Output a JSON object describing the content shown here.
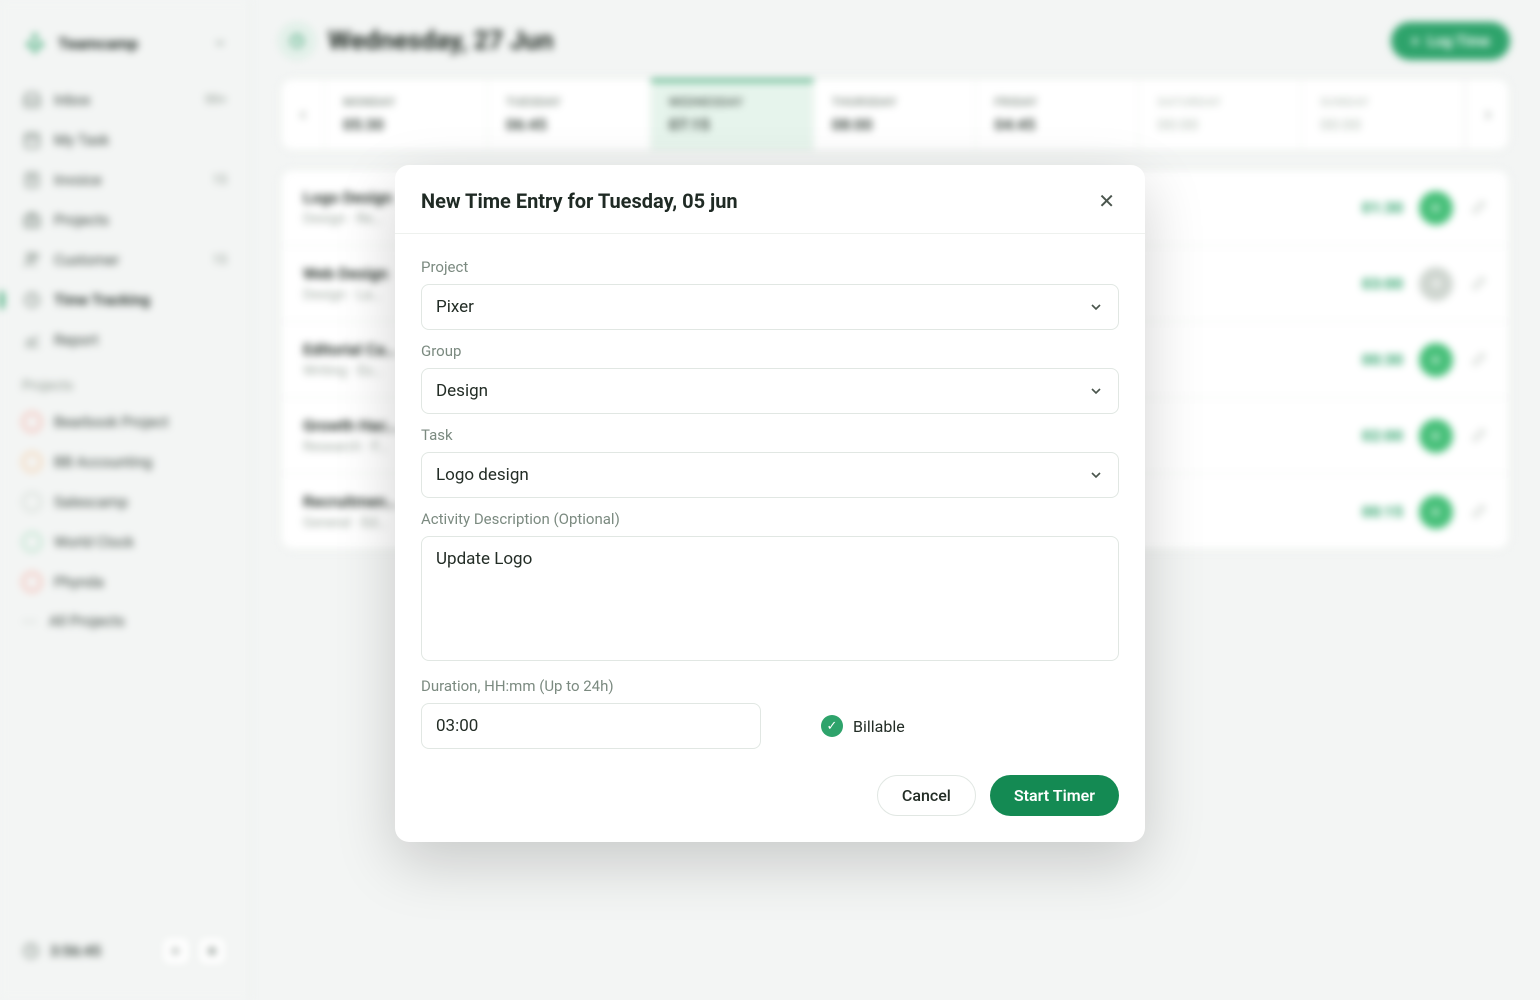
{
  "brand": {
    "name": "Teamcamp"
  },
  "nav": {
    "inbox": {
      "label": "Inbox",
      "badge": "99+"
    },
    "mytask": {
      "label": "My Task"
    },
    "invoice": {
      "label": "Invoice",
      "badge": "15"
    },
    "projects": {
      "label": "Projects"
    },
    "customer": {
      "label": "Customer",
      "badge": "15"
    },
    "time": {
      "label": "Time Tracking"
    },
    "report": {
      "label": "Report"
    }
  },
  "projects_section": {
    "title": "Projects",
    "items": [
      {
        "label": "Bearbook Project"
      },
      {
        "label": "BB Accounting"
      },
      {
        "label": "Salescamp"
      },
      {
        "label": "World Clock"
      },
      {
        "label": "Phynda"
      },
      {
        "label": "All Projects"
      }
    ]
  },
  "footer": {
    "timer": "3:56:45"
  },
  "header": {
    "title": "Wednesday, 27 Jun",
    "button": "Log Time"
  },
  "week": [
    {
      "name": "MONDAY",
      "time": "05:30"
    },
    {
      "name": "TUESDAY",
      "time": "06:45"
    },
    {
      "name": "WEDNESDAY",
      "time": "07:15",
      "active": true
    },
    {
      "name": "THURSDAY",
      "time": "08:00"
    },
    {
      "name": "FRIDAY",
      "time": "04:45"
    },
    {
      "name": "SATURDAY",
      "time": "00:00",
      "weekend": true
    },
    {
      "name": "SUNDAY",
      "time": "00:00",
      "weekend": true
    }
  ],
  "entries": [
    {
      "title": "Logo Design",
      "sub": "Design · Re…",
      "time": "01:30",
      "play": true
    },
    {
      "title": "Web Design",
      "sub": "Design · La…",
      "time": "03:00",
      "play": false
    },
    {
      "title": "Editorial Ca…",
      "sub": "Writing · Ex…",
      "time": "00:30",
      "play": true
    },
    {
      "title": "Growth Hac…",
      "sub": "Research · F…",
      "time": "02:00",
      "play": true
    },
    {
      "title": "Recruitmen…",
      "sub": "General · Ed…",
      "time": "00:15",
      "play": true
    }
  ],
  "modal": {
    "title": "New Time Entry for Tuesday, 05 jun",
    "labels": {
      "project": "Project",
      "group": "Group",
      "task": "Task",
      "activity": "Activity Description (Optional)",
      "duration": "Duration, HH:mm (Up to 24h)",
      "billable": "Billable"
    },
    "values": {
      "project": "Pixer",
      "group": "Design",
      "task": "Logo design",
      "activity": "Update Logo",
      "duration": "03:00"
    },
    "buttons": {
      "cancel": "Cancel",
      "start": "Start Timer"
    }
  }
}
